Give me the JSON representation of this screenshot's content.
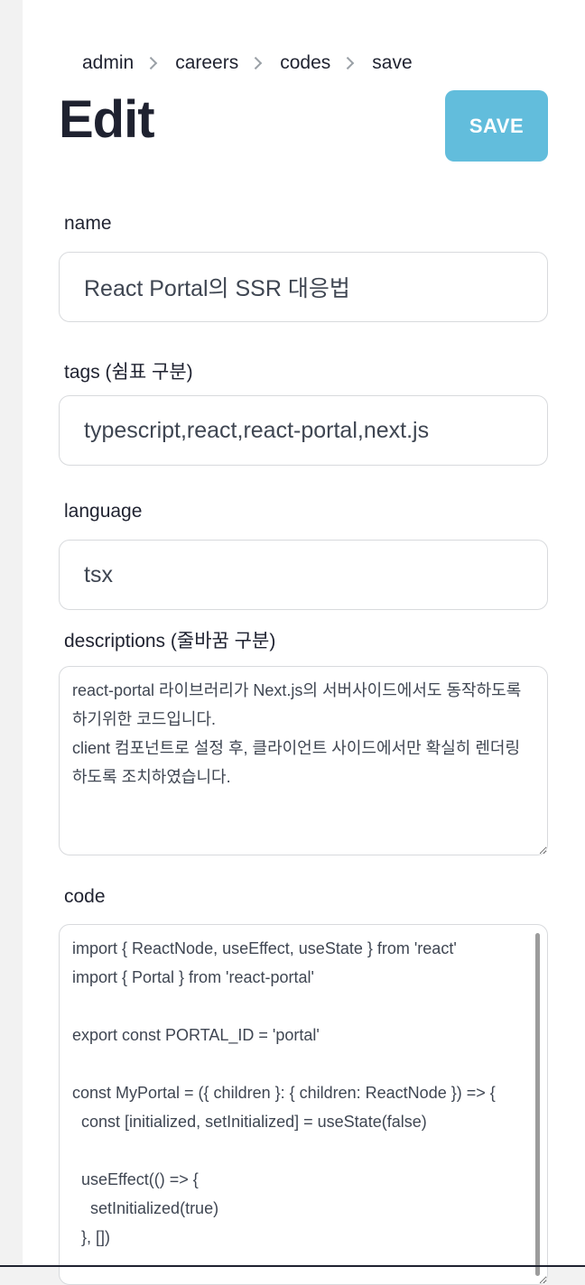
{
  "breadcrumb": [
    "admin",
    "careers",
    "codes",
    "save"
  ],
  "page_title": "Edit",
  "save_label": "SAVE",
  "fields": {
    "name": {
      "label": "name",
      "value": "React Portal의 SSR 대응법"
    },
    "tags": {
      "label": "tags (쉼표 구분)",
      "value": "typescript,react,react-portal,next.js"
    },
    "language": {
      "label": "language",
      "value": "tsx"
    },
    "descriptions": {
      "label": "descriptions (줄바꿈 구분)",
      "value": "react-portal 라이브러리가 Next.js의 서버사이드에서도 동작하도록 하기위한 코드입니다.\nclient 컴포넌트로 설정 후, 클라이언트 사이드에서만 확실히 렌더링하도록 조치하였습니다."
    },
    "code": {
      "label": "code",
      "value": "import { ReactNode, useEffect, useState } from 'react'\nimport { Portal } from 'react-portal'\n\nexport const PORTAL_ID = 'portal'\n\nconst MyPortal = ({ children }: { children: ReactNode }) => {\n  const [initialized, setInitialized] = useState(false)\n\n  useEffect(() => {\n    setInitialized(true)\n  }, [])"
    }
  }
}
